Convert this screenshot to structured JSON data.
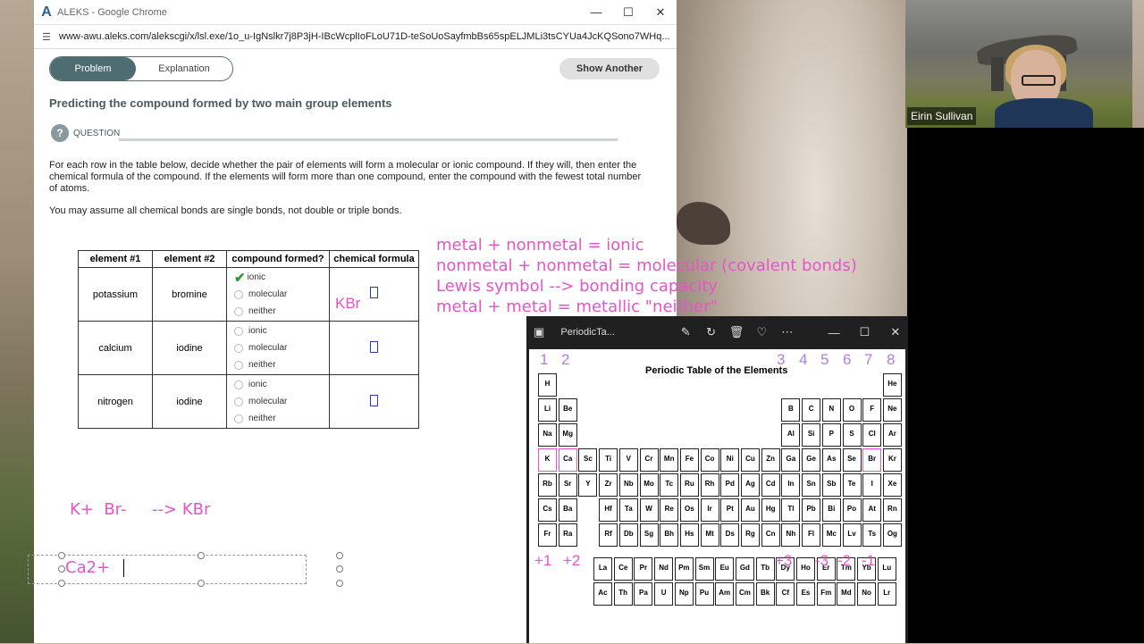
{
  "window": {
    "title": "ALEKS - Google Chrome",
    "url": "www-awu.aleks.com/alekscgi/x/lsl.exe/1o_u-IgNslkr7j8P3jH-IBcWcplIoFLoU71D-teSoUoSayfmbBs65spELJMLi3tsCYUa4JcKQSono7WHq..."
  },
  "tabs": {
    "problem": "Problem",
    "explanation": "Explanation"
  },
  "show_another": "Show Another",
  "heading": "Predicting the compound formed by two main group elements",
  "question_label": "QUESTION",
  "paragraph1": "For each row in the table below, decide whether the pair of elements will form a molecular or ionic compound. If they will, then enter the chemical formula of the compound. If the elements will form more than one compound, enter the compound with the fewest total number of atoms.",
  "paragraph2": "You may assume all chemical bonds are single bonds, not double or triple bonds.",
  "table": {
    "headers": [
      "element #1",
      "element #2",
      "compound formed?",
      "chemical formula"
    ],
    "options": [
      "ionic",
      "molecular",
      "neither"
    ],
    "rows": [
      {
        "el1": "potassium",
        "el2": "bromine",
        "formula": "KBr"
      },
      {
        "el1": "calcium",
        "el2": "iodine",
        "formula": ""
      },
      {
        "el1": "nitrogen",
        "el2": "iodine",
        "formula": ""
      }
    ]
  },
  "notes": {
    "line1": "metal + nonmetal = ionic",
    "line2": "nonmetal + nonmetal = molecular (covalent bonds)",
    "line3": "Lewis symbol --> bonding capacity",
    "line4": "metal + metal = metallic \"neither\"",
    "kbr_eq": "K+  Br-     --> KBr",
    "ca_text": "Ca2+"
  },
  "viewer": {
    "title": "PeriodicTa...",
    "pt_title": "Periodic Table of the Elements",
    "group_annots": [
      "1",
      "2",
      "3",
      "4",
      "5",
      "6",
      "7",
      "8"
    ],
    "charge_annots": [
      "+1",
      "+2",
      "+3",
      "-3",
      "-2",
      "-1"
    ]
  },
  "webcam": {
    "name": "Eirin Sullivan"
  }
}
